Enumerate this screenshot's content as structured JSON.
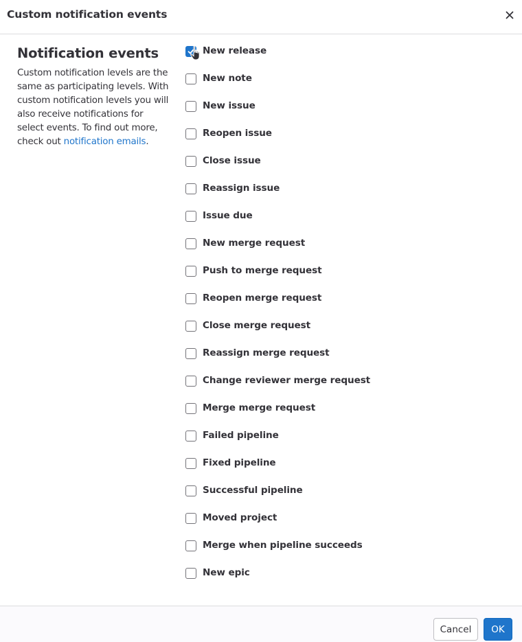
{
  "modal": {
    "title": "Custom notification events",
    "close_icon": "close-icon"
  },
  "sidebar": {
    "heading": "Notification events",
    "description_prefix": "Custom notification levels are the same as participating levels. With custom notification levels you will also receive notifications for select events. To find out more, check out ",
    "link_text": "notification emails",
    "description_suffix": "."
  },
  "events": [
    {
      "label": "New release",
      "checked": true
    },
    {
      "label": "New note",
      "checked": false
    },
    {
      "label": "New issue",
      "checked": false
    },
    {
      "label": "Reopen issue",
      "checked": false
    },
    {
      "label": "Close issue",
      "checked": false
    },
    {
      "label": "Reassign issue",
      "checked": false
    },
    {
      "label": "Issue due",
      "checked": false
    },
    {
      "label": "New merge request",
      "checked": false
    },
    {
      "label": "Push to merge request",
      "checked": false
    },
    {
      "label": "Reopen merge request",
      "checked": false
    },
    {
      "label": "Close merge request",
      "checked": false
    },
    {
      "label": "Reassign merge request",
      "checked": false
    },
    {
      "label": "Change reviewer merge request",
      "checked": false
    },
    {
      "label": "Merge merge request",
      "checked": false
    },
    {
      "label": "Failed pipeline",
      "checked": false
    },
    {
      "label": "Fixed pipeline",
      "checked": false
    },
    {
      "label": "Successful pipeline",
      "checked": false
    },
    {
      "label": "Moved project",
      "checked": false
    },
    {
      "label": "Merge when pipeline succeeds",
      "checked": false
    },
    {
      "label": "New epic",
      "checked": false
    }
  ],
  "footer": {
    "cancel_label": "Cancel",
    "ok_label": "OK"
  },
  "colors": {
    "accent": "#1f75cb",
    "text": "#333238",
    "border": "#dcdcde"
  }
}
